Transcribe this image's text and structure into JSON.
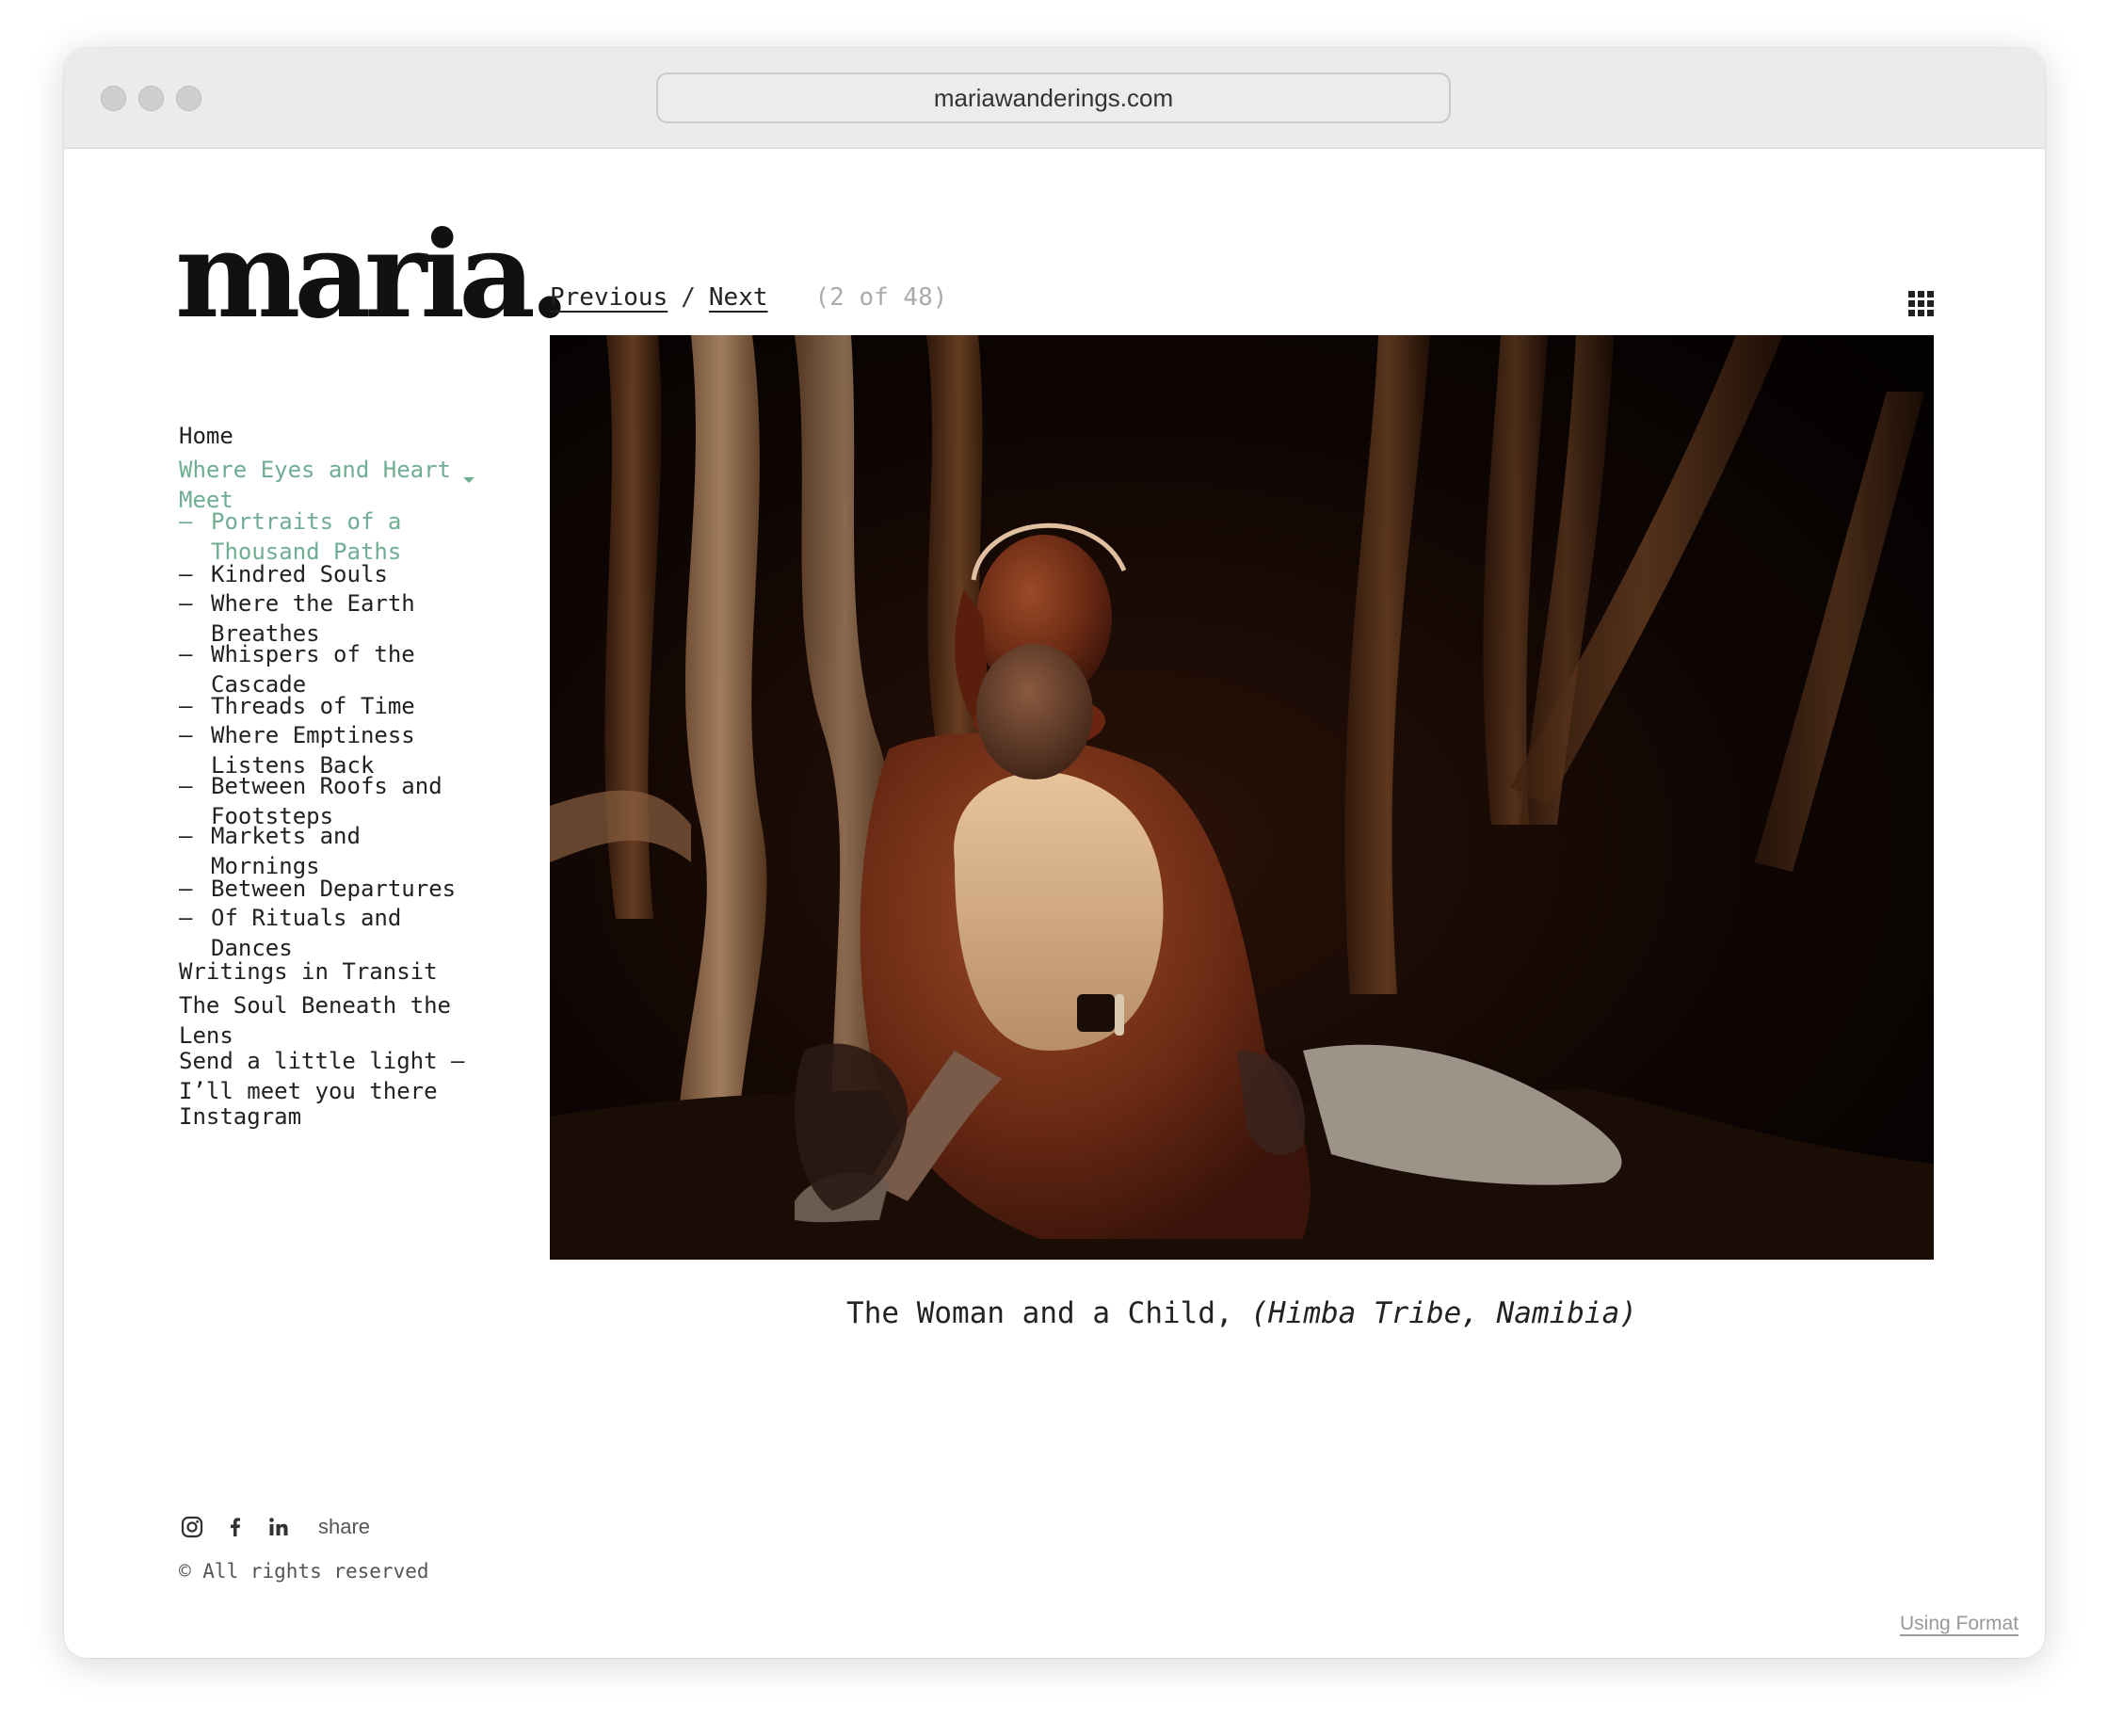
{
  "browser": {
    "url": "mariawanderings.com"
  },
  "site": {
    "logo": "maria."
  },
  "nav": {
    "home": "Home",
    "gallery_parent": "Where Eyes and Heart Meet",
    "gallery_items": [
      "Portraits of a Thousand Paths",
      "Kindred Souls",
      "Where the Earth Breathes",
      "Whispers of the Cascade",
      "Threads of Time",
      "Where Emptiness Listens Back",
      "Between Roofs and Footsteps",
      "Markets and Mornings",
      "Between Departures",
      "Of Rituals and Dances"
    ],
    "writings": "Writings in Transit",
    "soul": "The Soul Beneath the Lens",
    "contact": "Send a little light — I’ll meet you there",
    "instagram": "Instagram",
    "dash": "—"
  },
  "social": {
    "share_label": "share",
    "icons": [
      "instagram-icon",
      "facebook-icon",
      "linkedin-icon"
    ]
  },
  "footer": {
    "copyright": "© All rights reserved",
    "using_format": "Using Format"
  },
  "pager": {
    "previous": "Previous",
    "separator": "/",
    "next": "Next",
    "count": "(2 of 48)"
  },
  "caption": {
    "main": "The Woman and a Child,",
    "italic": "(Himba Tribe, Namibia)"
  },
  "colors": {
    "accent": "#6fae92",
    "text": "#222222"
  }
}
